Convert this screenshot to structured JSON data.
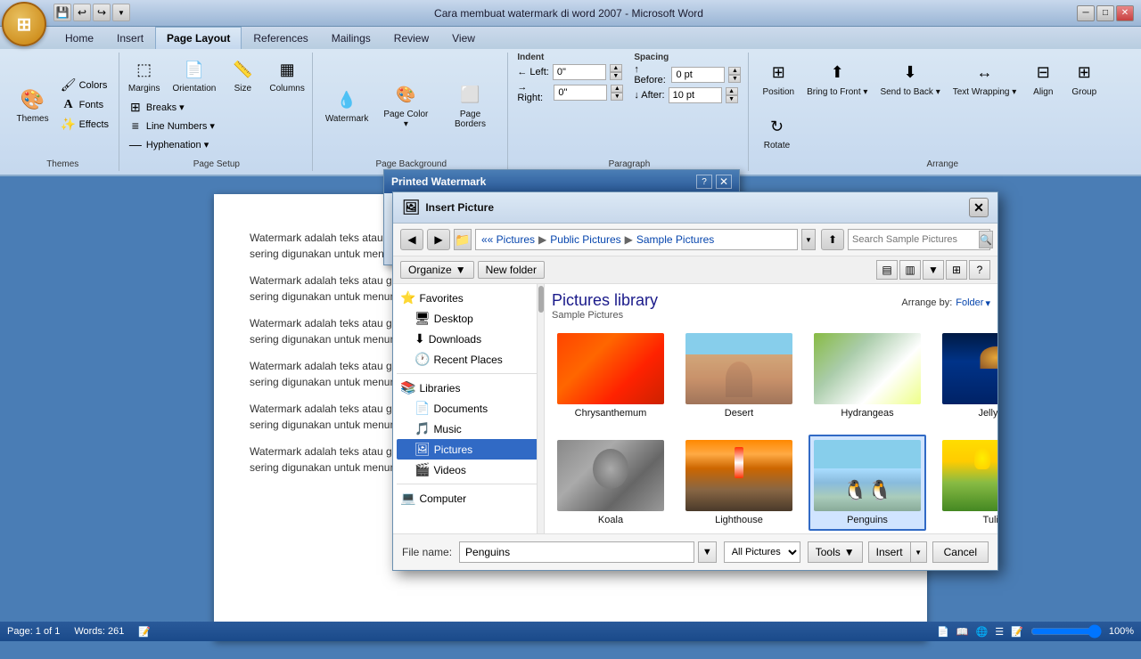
{
  "titleBar": {
    "title": "Cara membuat watermark di word 2007 - Microsoft Word",
    "minimizeBtn": "─",
    "maximizeBtn": "□",
    "closeBtn": "✕"
  },
  "ribbon": {
    "tabs": [
      "Home",
      "Insert",
      "Page Layout",
      "References",
      "Mailings",
      "Review",
      "View"
    ],
    "activeTab": "Page Layout",
    "groups": {
      "themes": {
        "label": "Themes",
        "buttons": [
          {
            "label": "Themes",
            "icon": "🎨"
          },
          {
            "label": "Colors",
            "icon": "🖌"
          },
          {
            "label": "Fonts",
            "icon": "A"
          },
          {
            "label": "Effects",
            "icon": "✨"
          }
        ]
      },
      "pageSetup": {
        "label": "Page Setup",
        "buttons": [
          "Margins",
          "Orientation",
          "Size",
          "Columns",
          "Breaks",
          "Line Numbers",
          "Hyphenation"
        ]
      },
      "pageBackground": {
        "label": "Page Background",
        "buttons": [
          "Watermark",
          "Page Color",
          "Page Borders"
        ]
      },
      "paragraph": {
        "label": "Paragraph",
        "indent": {
          "leftLabel": "Left:",
          "leftValue": "0\"",
          "rightLabel": "Right:",
          "rightValue": "0\""
        },
        "spacing": {
          "beforeLabel": "Before:",
          "beforeValue": "0 pt",
          "afterLabel": "After:",
          "afterValue": "10 pt"
        },
        "spacingTitle": "Spacing"
      },
      "arrange": {
        "label": "Arrange",
        "buttons": [
          "Position",
          "Bring to Front",
          "Send to Back",
          "Text Wrapping",
          "Align",
          "Group",
          "Rotate"
        ]
      }
    }
  },
  "watermarkDialog": {
    "title": "Printed Watermark",
    "closeBtn": "✕"
  },
  "insertDialog": {
    "title": "Insert Picture",
    "closeBtn": "✕",
    "navBtn": {
      "back": "◀",
      "forward": "▶"
    },
    "breadcrumb": [
      "Pictures",
      "Public Pictures",
      "Sample Pictures"
    ],
    "searchPlaceholder": "Search Sample Pictures",
    "toolbar": {
      "organize": "Organize",
      "newFolder": "New folder"
    },
    "sidebar": {
      "favorites": {
        "label": "Favorites",
        "items": [
          "Desktop",
          "Downloads",
          "Recent Places"
        ]
      },
      "libraries": {
        "label": "Libraries",
        "items": [
          "Documents",
          "Music",
          "Pictures",
          "Videos"
        ]
      },
      "computer": {
        "label": "Computer"
      }
    },
    "library": {
      "title": "Pictures library",
      "subtitle": "Sample Pictures",
      "arrangeBy": "Arrange by:",
      "arrangeValue": "Folder"
    },
    "pictures": [
      {
        "name": "Chrysanthemum",
        "thumb": "chrysanthemum"
      },
      {
        "name": "Desert",
        "thumb": "desert"
      },
      {
        "name": "Hydrangeas",
        "thumb": "hydrangeas"
      },
      {
        "name": "Jellyfish",
        "thumb": "jellyfish"
      },
      {
        "name": "Koala",
        "thumb": "koala"
      },
      {
        "name": "Lighthouse",
        "thumb": "lighthouse"
      },
      {
        "name": "Penguins",
        "thumb": "penguins",
        "selected": true
      },
      {
        "name": "Tulips",
        "thumb": "tulips"
      }
    ],
    "footer": {
      "fileNameLabel": "File name:",
      "fileName": "Penguins",
      "fileType": "All Pictures",
      "toolsLabel": "Tools",
      "insertLabel": "Insert",
      "cancelLabel": "Cancel"
    }
  },
  "document": {
    "paragraphs": [
      "Watermark adalah teks atau gambar transparan yang disisipkan di belakang teks untuk mempercantik dokumen Word. Watermark sering digunakan untuk menunjukkan seseorang yang.",
      "Watermark adalah teks atau gambar transparan yang disisipkan di belakang teks untuk mempercantik dokumen Word. Watermark sering digunakan untuk menunjukkan seseorang yang.",
      "Watermark adalah teks atau gambar transparan yang disisipkan di belakang teks untuk mempercantik dokumen Word. Watermark sering digunakan untuk menunjukkan seseorang yang.",
      "Watermark adalah teks atau gambar transparan yang disisipkan di belakang teks untuk mempercantik dokumen Word. Watermark sering digunakan untuk menunjukkan seseorang yang.",
      "Watermark adalah teks atau gambar transparan yang disisipkan di belakang teks untuk mempercantik dokumen Word. Watermark sering digunakan untuk menunjukkan seseorang yang.",
      "Watermark adalah teks atau gambar transparan yang disisipkan di belakang teks untuk mempercantik dokumen Word. Watermark sering digunakan untuk menunjukkan seseorang yang."
    ]
  },
  "statusBar": {
    "pageInfo": "Page: 1 of 1",
    "wordCount": "Words: 261",
    "zoom": "100%"
  }
}
